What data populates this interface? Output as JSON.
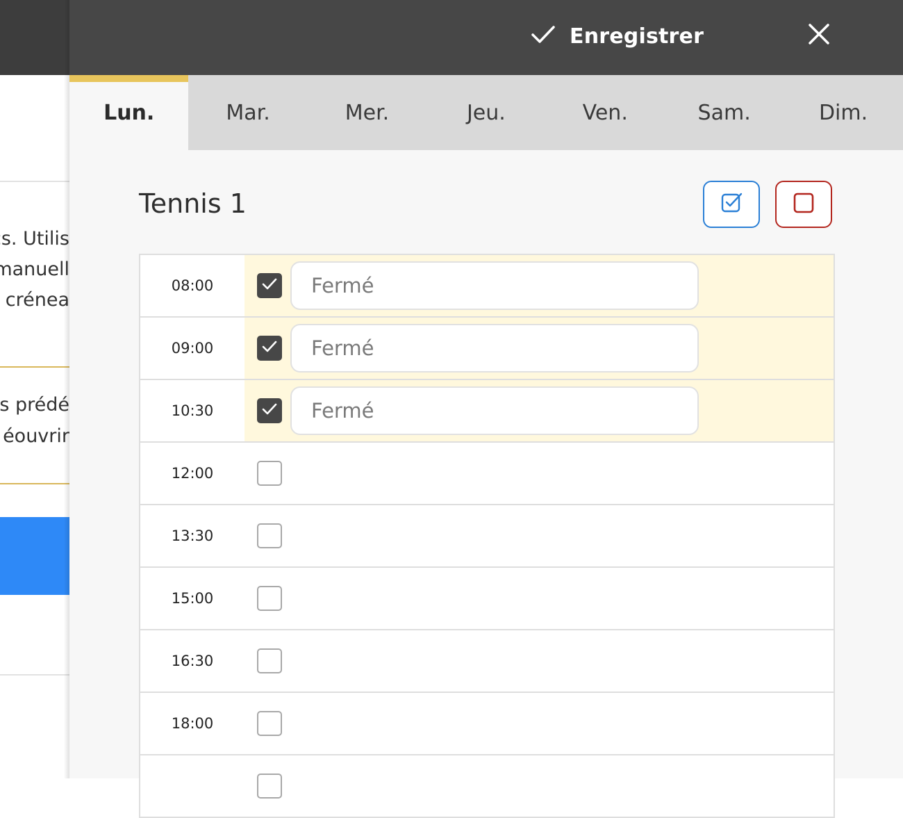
{
  "background": {
    "text_lines": [
      "cs. Utilis",
      "manuell",
      "s crénea",
      "s prédé",
      "éouvrir"
    ]
  },
  "header": {
    "save_label": "Enregistrer",
    "save_icon": "check-icon",
    "close_icon": "close-icon"
  },
  "tabs": [
    {
      "label": "Lun.",
      "active": true
    },
    {
      "label": "Mar.",
      "active": false
    },
    {
      "label": "Mer.",
      "active": false
    },
    {
      "label": "Jeu.",
      "active": false
    },
    {
      "label": "Ven.",
      "active": false
    },
    {
      "label": "Sam.",
      "active": false
    },
    {
      "label": "Dim.",
      "active": false
    }
  ],
  "court": {
    "title": "Tennis 1",
    "check_all_icon": "checkbox-checked-icon",
    "uncheck_all_icon": "checkbox-empty-icon"
  },
  "slots": [
    {
      "time": "08:00",
      "closed": true,
      "note": "Fermé"
    },
    {
      "time": "09:00",
      "closed": true,
      "note": "Fermé"
    },
    {
      "time": "10:30",
      "closed": true,
      "note": "Fermé"
    },
    {
      "time": "12:00",
      "closed": false
    },
    {
      "time": "13:30",
      "closed": false
    },
    {
      "time": "15:00",
      "closed": false
    },
    {
      "time": "16:30",
      "closed": false
    },
    {
      "time": "18:00",
      "closed": false
    },
    {
      "time": "",
      "closed": false
    }
  ],
  "colors": {
    "header_bg": "#474747",
    "tab_accent": "#e8c55c",
    "closed_row_bg": "#fff8dd",
    "check_all_border": "#2a7fd6",
    "uncheck_all_border": "#b3261e"
  }
}
